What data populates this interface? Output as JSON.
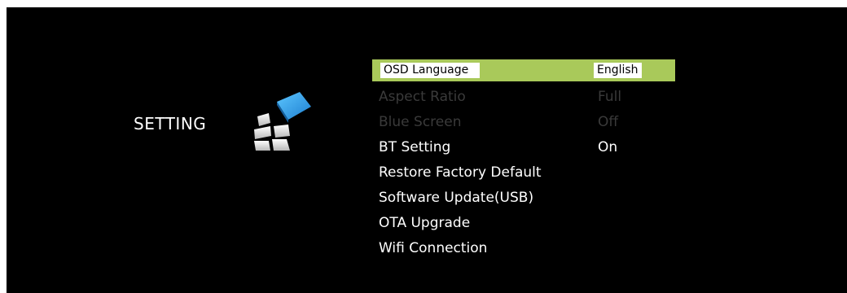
{
  "header": {
    "title": "SETTING"
  },
  "icon": {
    "name": "setting-icon",
    "accent": "#2f9fe6"
  },
  "highlight_color": "#a9c95a",
  "menu": {
    "items": [
      {
        "label": "OSD Language",
        "value": "English",
        "state": "selected"
      },
      {
        "label": "Aspect Ratio",
        "value": "Full",
        "state": "disabled"
      },
      {
        "label": "Blue Screen",
        "value": "Off",
        "state": "disabled"
      },
      {
        "label": "BT Setting",
        "value": "On",
        "state": "normal"
      },
      {
        "label": "Restore Factory Default",
        "value": "",
        "state": "normal"
      },
      {
        "label": "Software Update(USB)",
        "value": "",
        "state": "normal"
      },
      {
        "label": "OTA Upgrade",
        "value": "",
        "state": "normal"
      },
      {
        "label": "Wifi Connection",
        "value": "",
        "state": "normal"
      }
    ]
  }
}
